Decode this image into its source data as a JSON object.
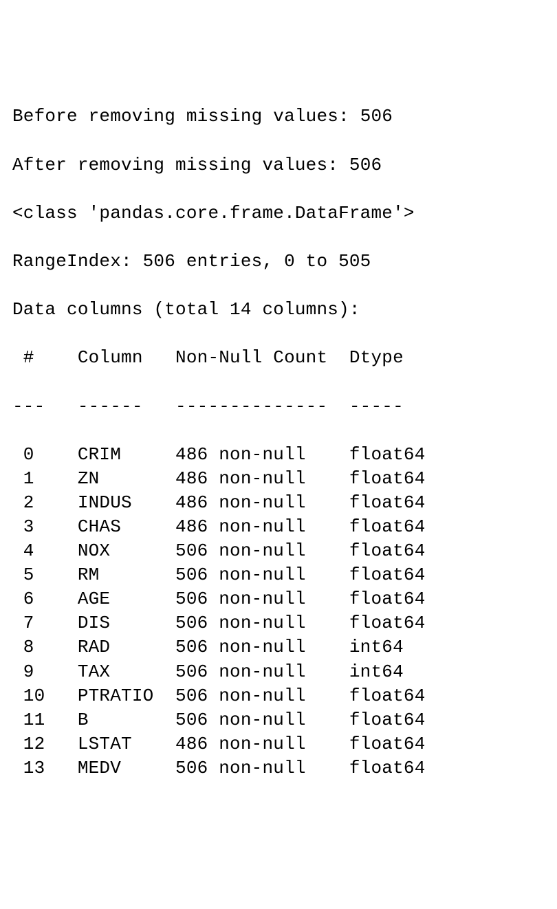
{
  "header": {
    "before_label": "Before removing missing values:",
    "before_count": "506",
    "after_label": "After removing missing values:",
    "after_count": "506",
    "class_line": "<class 'pandas.core.frame.DataFrame'>",
    "rangeindex_line": "RangeIndex: 506 entries, 0 to 505",
    "columns_line": "Data columns (total 14 columns):"
  },
  "table_header": {
    "idx": " #",
    "col": "Column",
    "nn": "Non-Null Count",
    "dtype": "Dtype"
  },
  "table_header_rule": {
    "idx": "---",
    "col": "------",
    "nn": "--------------",
    "dtype": "-----"
  },
  "rows": [
    {
      "idx": " 0",
      "col": "CRIM",
      "nn": "486 non-null",
      "dtype": "float64"
    },
    {
      "idx": " 1",
      "col": "ZN",
      "nn": "486 non-null",
      "dtype": "float64"
    },
    {
      "idx": " 2",
      "col": "INDUS",
      "nn": "486 non-null",
      "dtype": "float64"
    },
    {
      "idx": " 3",
      "col": "CHAS",
      "nn": "486 non-null",
      "dtype": "float64"
    },
    {
      "idx": " 4",
      "col": "NOX",
      "nn": "506 non-null",
      "dtype": "float64"
    },
    {
      "idx": " 5",
      "col": "RM",
      "nn": "506 non-null",
      "dtype": "float64"
    },
    {
      "idx": " 6",
      "col": "AGE",
      "nn": "506 non-null",
      "dtype": "float64"
    },
    {
      "idx": " 7",
      "col": "DIS",
      "nn": "506 non-null",
      "dtype": "float64"
    },
    {
      "idx": " 8",
      "col": "RAD",
      "nn": "506 non-null",
      "dtype": "int64"
    },
    {
      "idx": " 9",
      "col": "TAX",
      "nn": "506 non-null",
      "dtype": "int64"
    },
    {
      "idx": " 10",
      "col": "PTRATIO",
      "nn": "506 non-null",
      "dtype": "float64"
    },
    {
      "idx": " 11",
      "col": "B",
      "nn": "506 non-null",
      "dtype": "float64"
    },
    {
      "idx": " 12",
      "col": "LSTAT",
      "nn": "486 non-null",
      "dtype": "float64"
    },
    {
      "idx": " 13",
      "col": "MEDV",
      "nn": "506 non-null",
      "dtype": "float64"
    }
  ]
}
